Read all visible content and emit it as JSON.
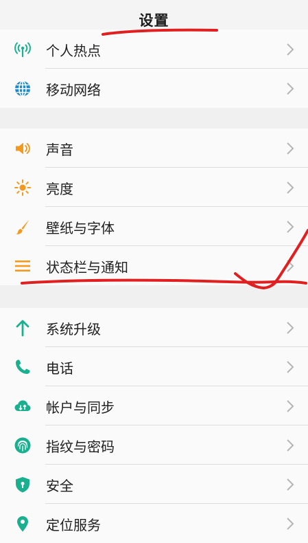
{
  "header": {
    "title": "设置"
  },
  "groups": [
    {
      "items": [
        {
          "label": "个人热点",
          "icon": "hotspot-icon"
        },
        {
          "label": "移动网络",
          "icon": "globe-icon"
        }
      ]
    },
    {
      "items": [
        {
          "label": "声音",
          "icon": "speaker-icon"
        },
        {
          "label": "亮度",
          "icon": "sun-icon"
        },
        {
          "label": "壁纸与字体",
          "icon": "paintbrush-icon"
        },
        {
          "label": "状态栏与通知",
          "icon": "list-icon"
        }
      ]
    },
    {
      "items": [
        {
          "label": "系统升级",
          "icon": "arrow-up-icon"
        },
        {
          "label": "电话",
          "icon": "phone-icon"
        },
        {
          "label": "帐户与同步",
          "icon": "cloud-sync-icon"
        },
        {
          "label": "指纹与密码",
          "icon": "fingerprint-icon"
        },
        {
          "label": "安全",
          "icon": "shield-icon"
        },
        {
          "label": "定位服务",
          "icon": "location-pin-icon"
        }
      ]
    }
  ],
  "colors": {
    "teal": "#1ab08f",
    "blue": "#1e88c9",
    "orange": "#f39a1e",
    "annotation_red": "#e02020"
  }
}
